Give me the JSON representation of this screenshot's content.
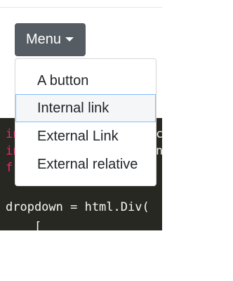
{
  "menu": {
    "label": "Menu",
    "items": [
      {
        "label": "A button"
      },
      {
        "label": "Internal link"
      },
      {
        "label": "External Link"
      },
      {
        "label": "External relative"
      }
    ]
  },
  "code": {
    "lines": [
      {
        "text": "in"
      },
      {
        "text": "in"
      },
      {
        "text": "fr"
      },
      {
        "text": ""
      },
      {
        "text": "dropdown = html.Div("
      },
      {
        "text": "    ["
      }
    ],
    "suffixes": [
      {
        "text": "c"
      },
      {
        "text": "n"
      }
    ]
  },
  "colors": {
    "menu_button": "#555c63",
    "code_background": "#272822",
    "keyword": "#f92672",
    "focus_outline": "#80bdff"
  }
}
